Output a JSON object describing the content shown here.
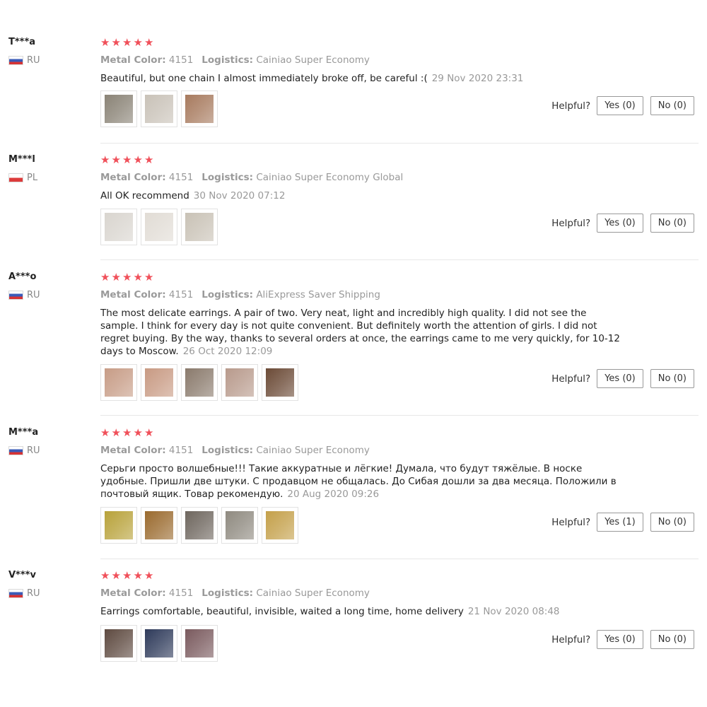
{
  "helpful_label": "Helpful?",
  "metal_label": "Metal Color:",
  "logistics_label": "Logistics:",
  "reviews": [
    {
      "user": "T***a",
      "country": "RU",
      "rating": 5,
      "metal_color": "4151",
      "logistics": "Cainiao Super Economy",
      "text": "Beautiful, but one chain I almost immediately broke off, be careful :(",
      "date": "29 Nov 2020 23:31",
      "photos": [
        "#8a8376",
        "#c9c2b8",
        "#a77a5e"
      ],
      "yes": "Yes (0)",
      "no": "No (0)"
    },
    {
      "user": "M***l",
      "country": "PL",
      "rating": 5,
      "metal_color": "4151",
      "logistics": "Cainiao Super Economy Global",
      "text": "All OK recommend",
      "date": "30 Nov 2020 07:12",
      "photos": [
        "#d9d5cf",
        "#e1dcd5",
        "#c9c2b6"
      ],
      "yes": "Yes (0)",
      "no": "No (0)"
    },
    {
      "user": "A***o",
      "country": "RU",
      "rating": 5,
      "metal_color": "4151",
      "logistics": "AliExpress Saver Shipping",
      "text": "The most delicate earrings. A pair of two. Very neat, light and incredibly high quality. I did not see the sample. I think for every day is not quite convenient. But definitely worth the attention of girls. I did not regret buying. By the way, thanks to several orders at once, the earrings came to me very quickly, for 10-12 days to Moscow.",
      "date": "26 Oct 2020 12:09",
      "photos": [
        "#c79c86",
        "#c89a83",
        "#8a7a6c",
        "#b89a8c",
        "#6b4a36"
      ],
      "yes": "Yes (0)",
      "no": "No (0)"
    },
    {
      "user": "M***a",
      "country": "RU",
      "rating": 5,
      "metal_color": "4151",
      "logistics": "Cainiao Super Economy",
      "text": "Серьги просто волшебные!!! Такие аккуратные и лёгкие! Думала, что будут тяжёлые. В носке удобные. Пришли две штуки. С продавцом не общалась. До Сибая дошли за два месяца. Положили в почтовый ящик. Товар рекомендую.",
      "date": "20 Aug 2020 09:26",
      "photos": [
        "#b8a23a",
        "#9a6a2e",
        "#6e665e",
        "#8f8a80",
        "#c4a04a"
      ],
      "yes": "Yes (1)",
      "no": "No (0)"
    },
    {
      "user": "V***v",
      "country": "RU",
      "rating": 5,
      "metal_color": "4151",
      "logistics": "Cainiao Super Economy",
      "text": "Earrings comfortable, beautiful, invisible, waited a long time, home delivery",
      "date": "21 Nov 2020 08:48",
      "photos": [
        "#5e4a40",
        "#2e3a5a",
        "#7a5a5e"
      ],
      "yes": "Yes (0)",
      "no": "No (0)"
    }
  ]
}
